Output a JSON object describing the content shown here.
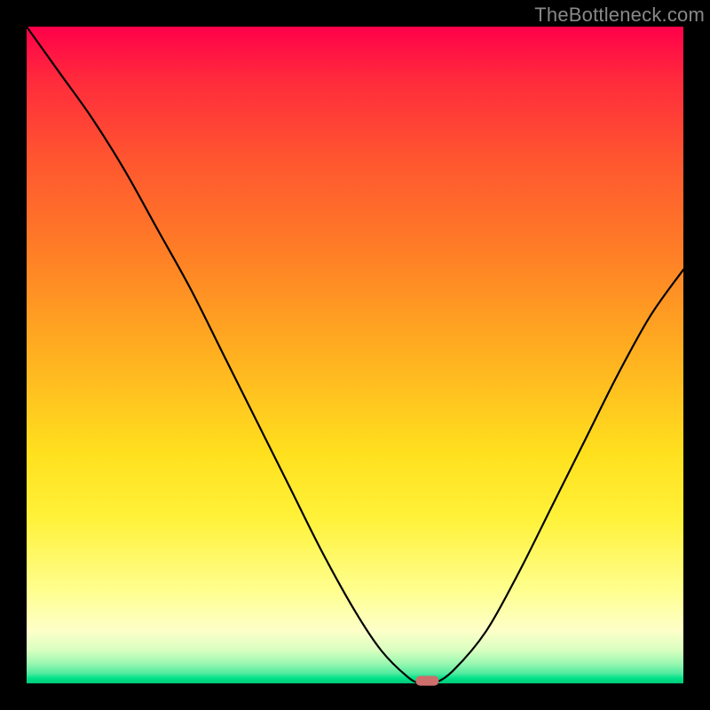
{
  "watermark": "TheBottleneck.com",
  "colors": {
    "frame": "#000000",
    "watermark": "#888888",
    "curve": "#000000",
    "marker": "#cc6f6c",
    "gradient_stops": [
      "#ff004a",
      "#ff2a3c",
      "#ff5530",
      "#ff8026",
      "#ffb020",
      "#ffe01e",
      "#fff23a",
      "#ffff90",
      "#fdffc8",
      "#d8ffc0",
      "#98f7b0",
      "#50eaa0",
      "#00e389",
      "#00c878"
    ]
  },
  "chart_data": {
    "type": "line",
    "title": "",
    "xlabel": "",
    "ylabel": "",
    "xlim": [
      0,
      100
    ],
    "ylim": [
      0,
      100
    ],
    "grid": false,
    "legend": false,
    "series": [
      {
        "name": "bottleneck-curve",
        "x": [
          0,
          5,
          10,
          15,
          20,
          25,
          30,
          35,
          40,
          45,
          50,
          54,
          58,
          60,
          62,
          65,
          70,
          75,
          80,
          85,
          90,
          95,
          100
        ],
        "y": [
          100,
          93,
          86,
          78,
          69,
          60,
          50,
          40,
          30,
          20,
          11,
          5,
          1,
          0,
          0,
          2,
          8,
          17,
          27,
          37,
          47,
          56,
          63
        ]
      }
    ],
    "marker": {
      "name": "min-bottleneck-marker",
      "x": 61,
      "y": 0.4,
      "shape": "rounded-rect",
      "width": 3.5,
      "height": 1.5
    }
  }
}
